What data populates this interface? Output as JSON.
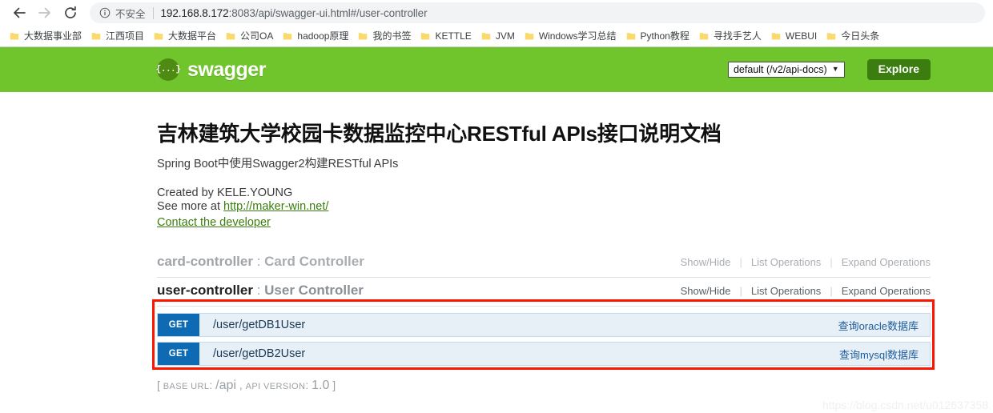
{
  "browser": {
    "nav": {
      "back_icon": "arrow-left-icon",
      "forward_icon": "arrow-right-icon",
      "reload_icon": "reload-icon"
    },
    "omnibox": {
      "info_icon": "info-circle-icon",
      "security_label": "不安全",
      "url": "192.168.8.172:8083/api/swagger-ui.html#/user-controller",
      "url_host": "192.168.8.172",
      "url_rest": ":8083/api/swagger-ui.html#/user-controller"
    },
    "bookmarks": {
      "folder_icon": "folder-icon",
      "items": [
        {
          "label": "大数据事业部"
        },
        {
          "label": "江西项目"
        },
        {
          "label": "大数据平台"
        },
        {
          "label": "公司OA"
        },
        {
          "label": "hadoop原理"
        },
        {
          "label": "我的书签"
        },
        {
          "label": "KETTLE"
        },
        {
          "label": "JVM"
        },
        {
          "label": "Windows学习总结"
        },
        {
          "label": "Python教程"
        },
        {
          "label": "寻找手艺人"
        },
        {
          "label": "WEBUI"
        },
        {
          "label": "今日头条"
        }
      ]
    }
  },
  "swagger_header": {
    "logo_mark": "{...}",
    "logo_text": "swagger",
    "api_select_value": "default (/v2/api-docs)",
    "api_select_caret": "▼",
    "explore_label": "Explore",
    "bar_color": "#6fc52b",
    "explore_color": "#3b7d0e"
  },
  "doc": {
    "title": "吉林建筑大学校园卡数据监控中心RESTful APIs接口说明文档",
    "subtitle": "Spring Boot中使用Swagger2构建RESTful APIs",
    "created_by": "Created by KELE.YOUNG",
    "see_more_prefix": "See more at ",
    "see_more_link": "http://maker-win.net/",
    "contact_link": "Contact the developer",
    "link_color": "#3b7d0e"
  },
  "resources": [
    {
      "id": "card-controller",
      "separator": " : ",
      "description": "Card Controller",
      "state": "muted",
      "ops": {
        "show_hide": "Show/Hide",
        "list": "List Operations",
        "expand": "Expand Operations",
        "sep": "|"
      }
    },
    {
      "id": "user-controller",
      "separator": " : ",
      "description": "User Controller",
      "state": "active",
      "ops": {
        "show_hide": "Show/Hide",
        "list": "List Operations",
        "expand": "Expand Operations",
        "sep": "|"
      }
    }
  ],
  "endpoints": [
    {
      "method": "GET",
      "path": "/user/getDB1User",
      "description": "查询oracle数据库",
      "method_color": "#0f6ab4"
    },
    {
      "method": "GET",
      "path": "/user/getDB2User",
      "description": "查询mysql数据库",
      "method_color": "#0f6ab4"
    }
  ],
  "annotation": {
    "shape": "rectangle",
    "color": "#fc1500"
  },
  "footer": {
    "open_bracket": "[ ",
    "base_url_label": "BASE URL",
    "base_url_sep": ": ",
    "base_url_value": "/api",
    "comma": " , ",
    "api_version_label": "API VERSION",
    "api_version_sep": ": ",
    "api_version_value": "1.0",
    "close_bracket": " ]"
  },
  "watermark": "https://blog.csdn.net/u012637358"
}
